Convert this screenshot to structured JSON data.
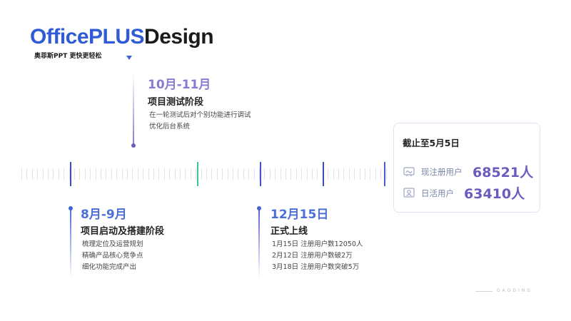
{
  "brand": {
    "part1": "OfficePLUS",
    "part2": "Design",
    "tagline": "奥菲斯PPT 更快更轻松"
  },
  "milestones": [
    {
      "title": "10月-11月",
      "subtitle": "项目测试阶段",
      "lines": [
        "在一轮测试后对个别功能进行调试",
        "优化后台系统"
      ],
      "color": "#8a7ad0"
    },
    {
      "title": "8月-9月",
      "subtitle": "项目启动及搭建阶段",
      "lines": [
        "梳理定位及运营规划",
        "精确产品核心竞争点",
        "细化功能完成产出"
      ],
      "color": "#4b6fd8"
    },
    {
      "title": "12月15日",
      "subtitle": "正式上线",
      "lines": [
        "1月15日 注册用户数12050人",
        "2月12日 注册用户数破2万",
        "3月18日 注册用户数突破5万"
      ],
      "color": "#4b6fd8"
    }
  ],
  "card": {
    "heading": "截止至5月5日",
    "stats": [
      {
        "label": "现注册用户",
        "value": "68521人",
        "icon": "registered-users-icon"
      },
      {
        "label": "日活用户",
        "value": "63410人",
        "icon": "daily-active-users-icon"
      }
    ]
  },
  "footer": {
    "text": "GAODING"
  },
  "colors": {
    "brand_blue": "#2f5bd6",
    "purple": "#6c5bbd",
    "accent_green": "#3cc79a"
  }
}
